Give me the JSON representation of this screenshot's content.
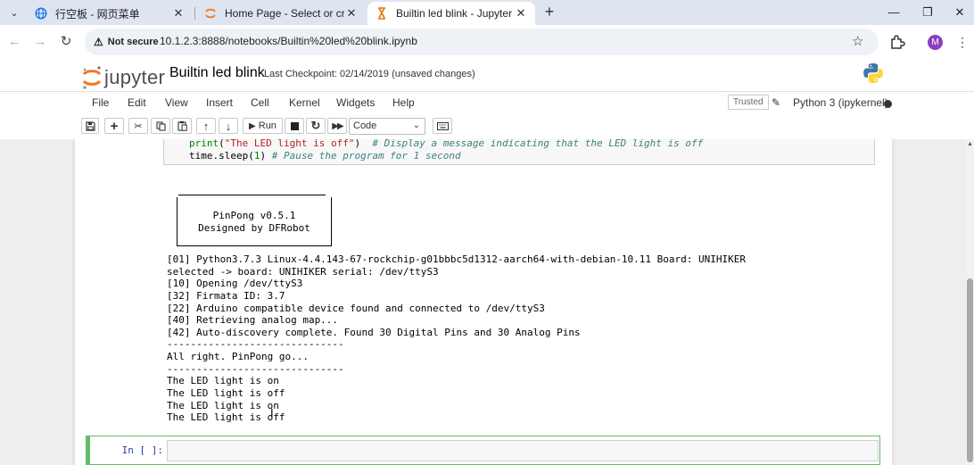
{
  "browser": {
    "tabs": [
      {
        "title": "行空板 - 网页菜单",
        "icon": "globe-icon",
        "active": false
      },
      {
        "title": "Home Page - Select or create a",
        "icon": "jupyter-icon",
        "active": false
      },
      {
        "title": "Builtin led blink - Jupyter Notel",
        "icon": "hourglass-icon",
        "active": true
      }
    ],
    "new_tab": "+",
    "window": {
      "minimize": "—",
      "restore": "❐",
      "close": "✕"
    },
    "address": {
      "security_label": "Not secure",
      "url": "10.1.2.3:8888/notebooks/Builtin%20led%20blink.ipynb"
    },
    "profile_initial": "M"
  },
  "jupyter": {
    "logo_text": "jupyter",
    "notebook_name": "Builtin led blink",
    "checkpoint": "Last Checkpoint: 02/14/2019  (unsaved changes)",
    "menu": [
      "File",
      "Edit",
      "View",
      "Insert",
      "Cell",
      "Kernel",
      "Widgets",
      "Help"
    ],
    "trusted": "Trusted",
    "kernel": "Python 3 (ipykernel)",
    "toolbar": {
      "run_label": "Run",
      "cell_type": "Code"
    }
  },
  "cell_tail": {
    "line1": {
      "func": "print",
      "open": "(",
      "string": "\"The LED light is off\"",
      "close": ")  ",
      "comment": "# Display a message indicating that the LED light is off"
    },
    "line2": {
      "pre": "time.sleep(",
      "num": "1",
      "post": ") ",
      "comment": "# Pause the program for 1 second"
    }
  },
  "output": {
    "banner": [
      "PinPong v0.5.1",
      "Designed by DFRobot"
    ],
    "lines": [
      "[01] Python3.7.3 Linux-4.4.143-67-rockchip-g01bbbc5d1312-aarch64-with-debian-10.11 Board: UNIHIKER",
      "selected -> board: UNIHIKER serial: /dev/ttyS3",
      "[10] Opening /dev/ttyS3",
      "[32] Firmata ID: 3.7",
      "[22] Arduino compatible device found and connected to /dev/ttyS3",
      "[40] Retrieving analog map...",
      "[42] Auto-discovery complete. Found 30 Digital Pins and 30 Analog Pins",
      "------------------------------",
      "All right. PinPong go...",
      "------------------------------",
      "The LED light is on",
      "The LED light is off",
      "The LED light is on",
      "The LED light is off"
    ]
  },
  "next_cell": {
    "prompt": "In [ ]:"
  }
}
